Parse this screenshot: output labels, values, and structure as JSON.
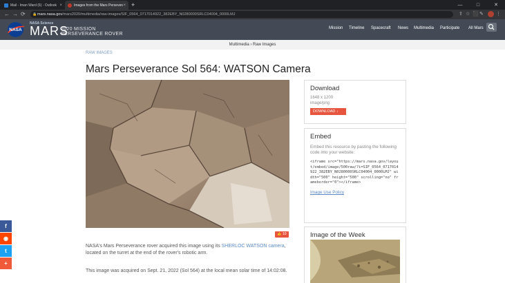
{
  "browser": {
    "tabs": [
      {
        "title": "Mail - Iman Ward (6) - Outlook",
        "close": "×"
      },
      {
        "title": "Images from the Mars Perseverance",
        "close": "×"
      }
    ],
    "new_tab": "+",
    "window_controls": [
      "—",
      "□",
      "✕"
    ],
    "url_host": "mars.nasa.gov",
    "url_path": "/mars2020/multimedia/raw-images/SIF_0564_0717014922_382EBY_N0280000SRLC04004_0000LMJ",
    "nav": {
      "back": "←",
      "forward": "→",
      "reload": "⟳"
    },
    "toolbar_icons": [
      "⇪",
      "☆",
      "⬛",
      "✎",
      "⧉"
    ],
    "colors": {
      "tabbar": "#202124",
      "toolbar": "#35363a",
      "profile": "#b04030"
    }
  },
  "site": {
    "nasa_science": "NASA Science",
    "mars": "MARS",
    "mission_line1": "2020 MISSION",
    "mission_line2": "PERSEVERANCE ROVER",
    "nav_items": [
      "Mission",
      "Timeline",
      "Spacecraft",
      "News",
      "Multimedia",
      "Participate"
    ],
    "all_mars": "All Mars",
    "search_icon": "search-icon",
    "header_color": "#434a56"
  },
  "subnav": "Multimedia › Raw Images",
  "breadcrumb": "RAW IMAGES",
  "title": "Mars Perseverance Sol 564: WATSON Camera",
  "like": {
    "icon": "thumbs-up-icon",
    "count": "10"
  },
  "description": {
    "p1_before": "NASA's Mars Perseverance rover acquired this image using its ",
    "p1_link": "SHERLOC WATSON camera",
    "p1_after": ", located on the turret at the end of the rover's robotic arm.",
    "p2": "This image was acquired on Sept. 21, 2022 (Sol 564) at the local mean solar time of 14:02:08."
  },
  "download": {
    "heading": "Download",
    "dimensions": "1648 x 1200",
    "format": "image/png",
    "button": "DOWNLOAD",
    "button_color": "#e8553e"
  },
  "embed": {
    "heading": "Embed",
    "desc": "Embed this resource by pasting the following code into your website:",
    "code": "<iframe src=\"https://mars.nasa.gov/layout/embed/image/500raw/?i=SIF_0564_0717014922_382EBY_N0280000SRLC04004_0000LMJ\" width=\"500\" height=\"500\" scrolling=\"no\" frameborder=\"0\"></iframe>",
    "policy": "Image Use Policy"
  },
  "iotw": {
    "heading": "Image of the Week"
  },
  "share": [
    {
      "icon": "facebook-icon",
      "glyph": "f",
      "color": "#3b5998"
    },
    {
      "icon": "reddit-icon",
      "glyph": "◉",
      "color": "#ff4500"
    },
    {
      "icon": "twitter-icon",
      "glyph": "t",
      "color": "#1da1f2"
    },
    {
      "icon": "more-share-icon",
      "glyph": "+",
      "color": "#f05a38"
    }
  ]
}
